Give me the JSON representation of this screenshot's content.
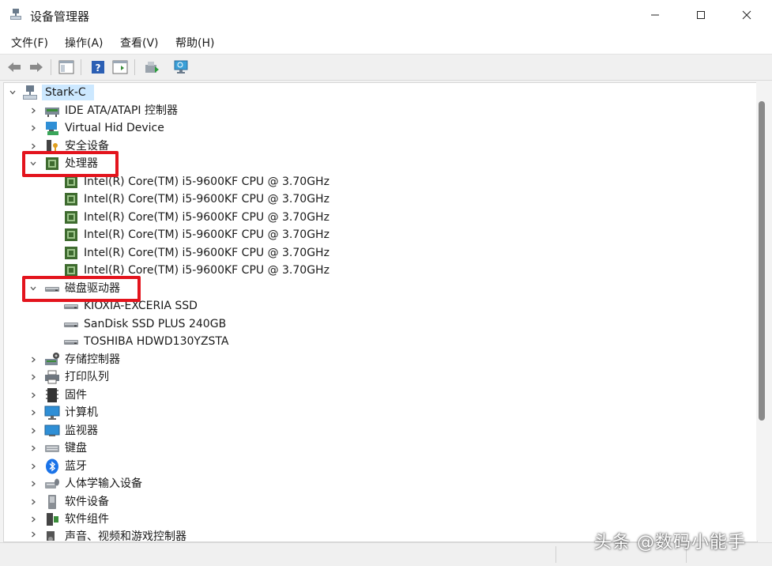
{
  "window": {
    "title": "设备管理器",
    "controls": {
      "minimize": "—",
      "maximize": "☐",
      "close": "✕"
    }
  },
  "menu": {
    "file": "文件(F)",
    "action": "操作(A)",
    "view": "查看(V)",
    "help": "帮助(H)"
  },
  "tree": {
    "root": "Stark-C",
    "items": {
      "ide": "IDE ATA/ATAPI 控制器",
      "hid": "Virtual Hid Device",
      "security": "安全设备",
      "processors": "处理器",
      "cpu1": "Intel(R) Core(TM) i5-9600KF CPU @ 3.70GHz",
      "cpu2": "Intel(R) Core(TM) i5-9600KF CPU @ 3.70GHz",
      "cpu3": "Intel(R) Core(TM) i5-9600KF CPU @ 3.70GHz",
      "cpu4": "Intel(R) Core(TM) i5-9600KF CPU @ 3.70GHz",
      "cpu5": "Intel(R) Core(TM) i5-9600KF CPU @ 3.70GHz",
      "cpu6": "Intel(R) Core(TM) i5-9600KF CPU @ 3.70GHz",
      "disks": "磁盘驱动器",
      "disk1": "KIOXIA-EXCERIA SSD",
      "disk2": "SanDisk SSD PLUS 240GB",
      "disk3": "TOSHIBA HDWD130YZSTA",
      "storage": "存储控制器",
      "printq": "打印队列",
      "firmware": "固件",
      "computer": "计算机",
      "monitors": "监视器",
      "keyboard": "键盘",
      "bluetooth": "蓝牙",
      "hid_input": "人体学输入设备",
      "software_dev": "软件设备",
      "software_comp": "软件组件",
      "sound": "声音、视频和游戏控制器"
    }
  },
  "watermark": "头条 @数码小能手",
  "colors": {
    "highlight_box": "#e3141d",
    "selection": "#cce8ff",
    "bluetooth": "#1a73e8"
  }
}
